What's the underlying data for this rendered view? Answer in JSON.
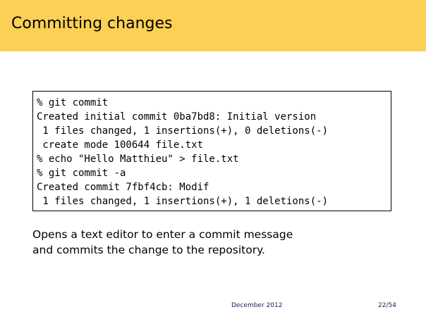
{
  "slide": {
    "title": "Committing changes",
    "code_lines": [
      "% git commit",
      "Created initial commit 0ba7bd8: Initial version",
      " 1 files changed, 1 insertions(+), 0 deletions(-)",
      " create mode 100644 file.txt",
      "% echo \"Hello Matthieu\" > file.txt",
      "% git commit -a",
      "Created commit 7fbf4cb: Modif",
      " 1 files changed, 1 insertions(+), 1 deletions(-)"
    ],
    "description_lines": [
      "Opens a text editor to enter a commit message",
      "and commits the change to the repository."
    ]
  },
  "footer": {
    "date": "December 2012",
    "page": "22/54"
  },
  "colors": {
    "title_bar": "#fcd055",
    "footer_text": "#1a1a5e"
  }
}
